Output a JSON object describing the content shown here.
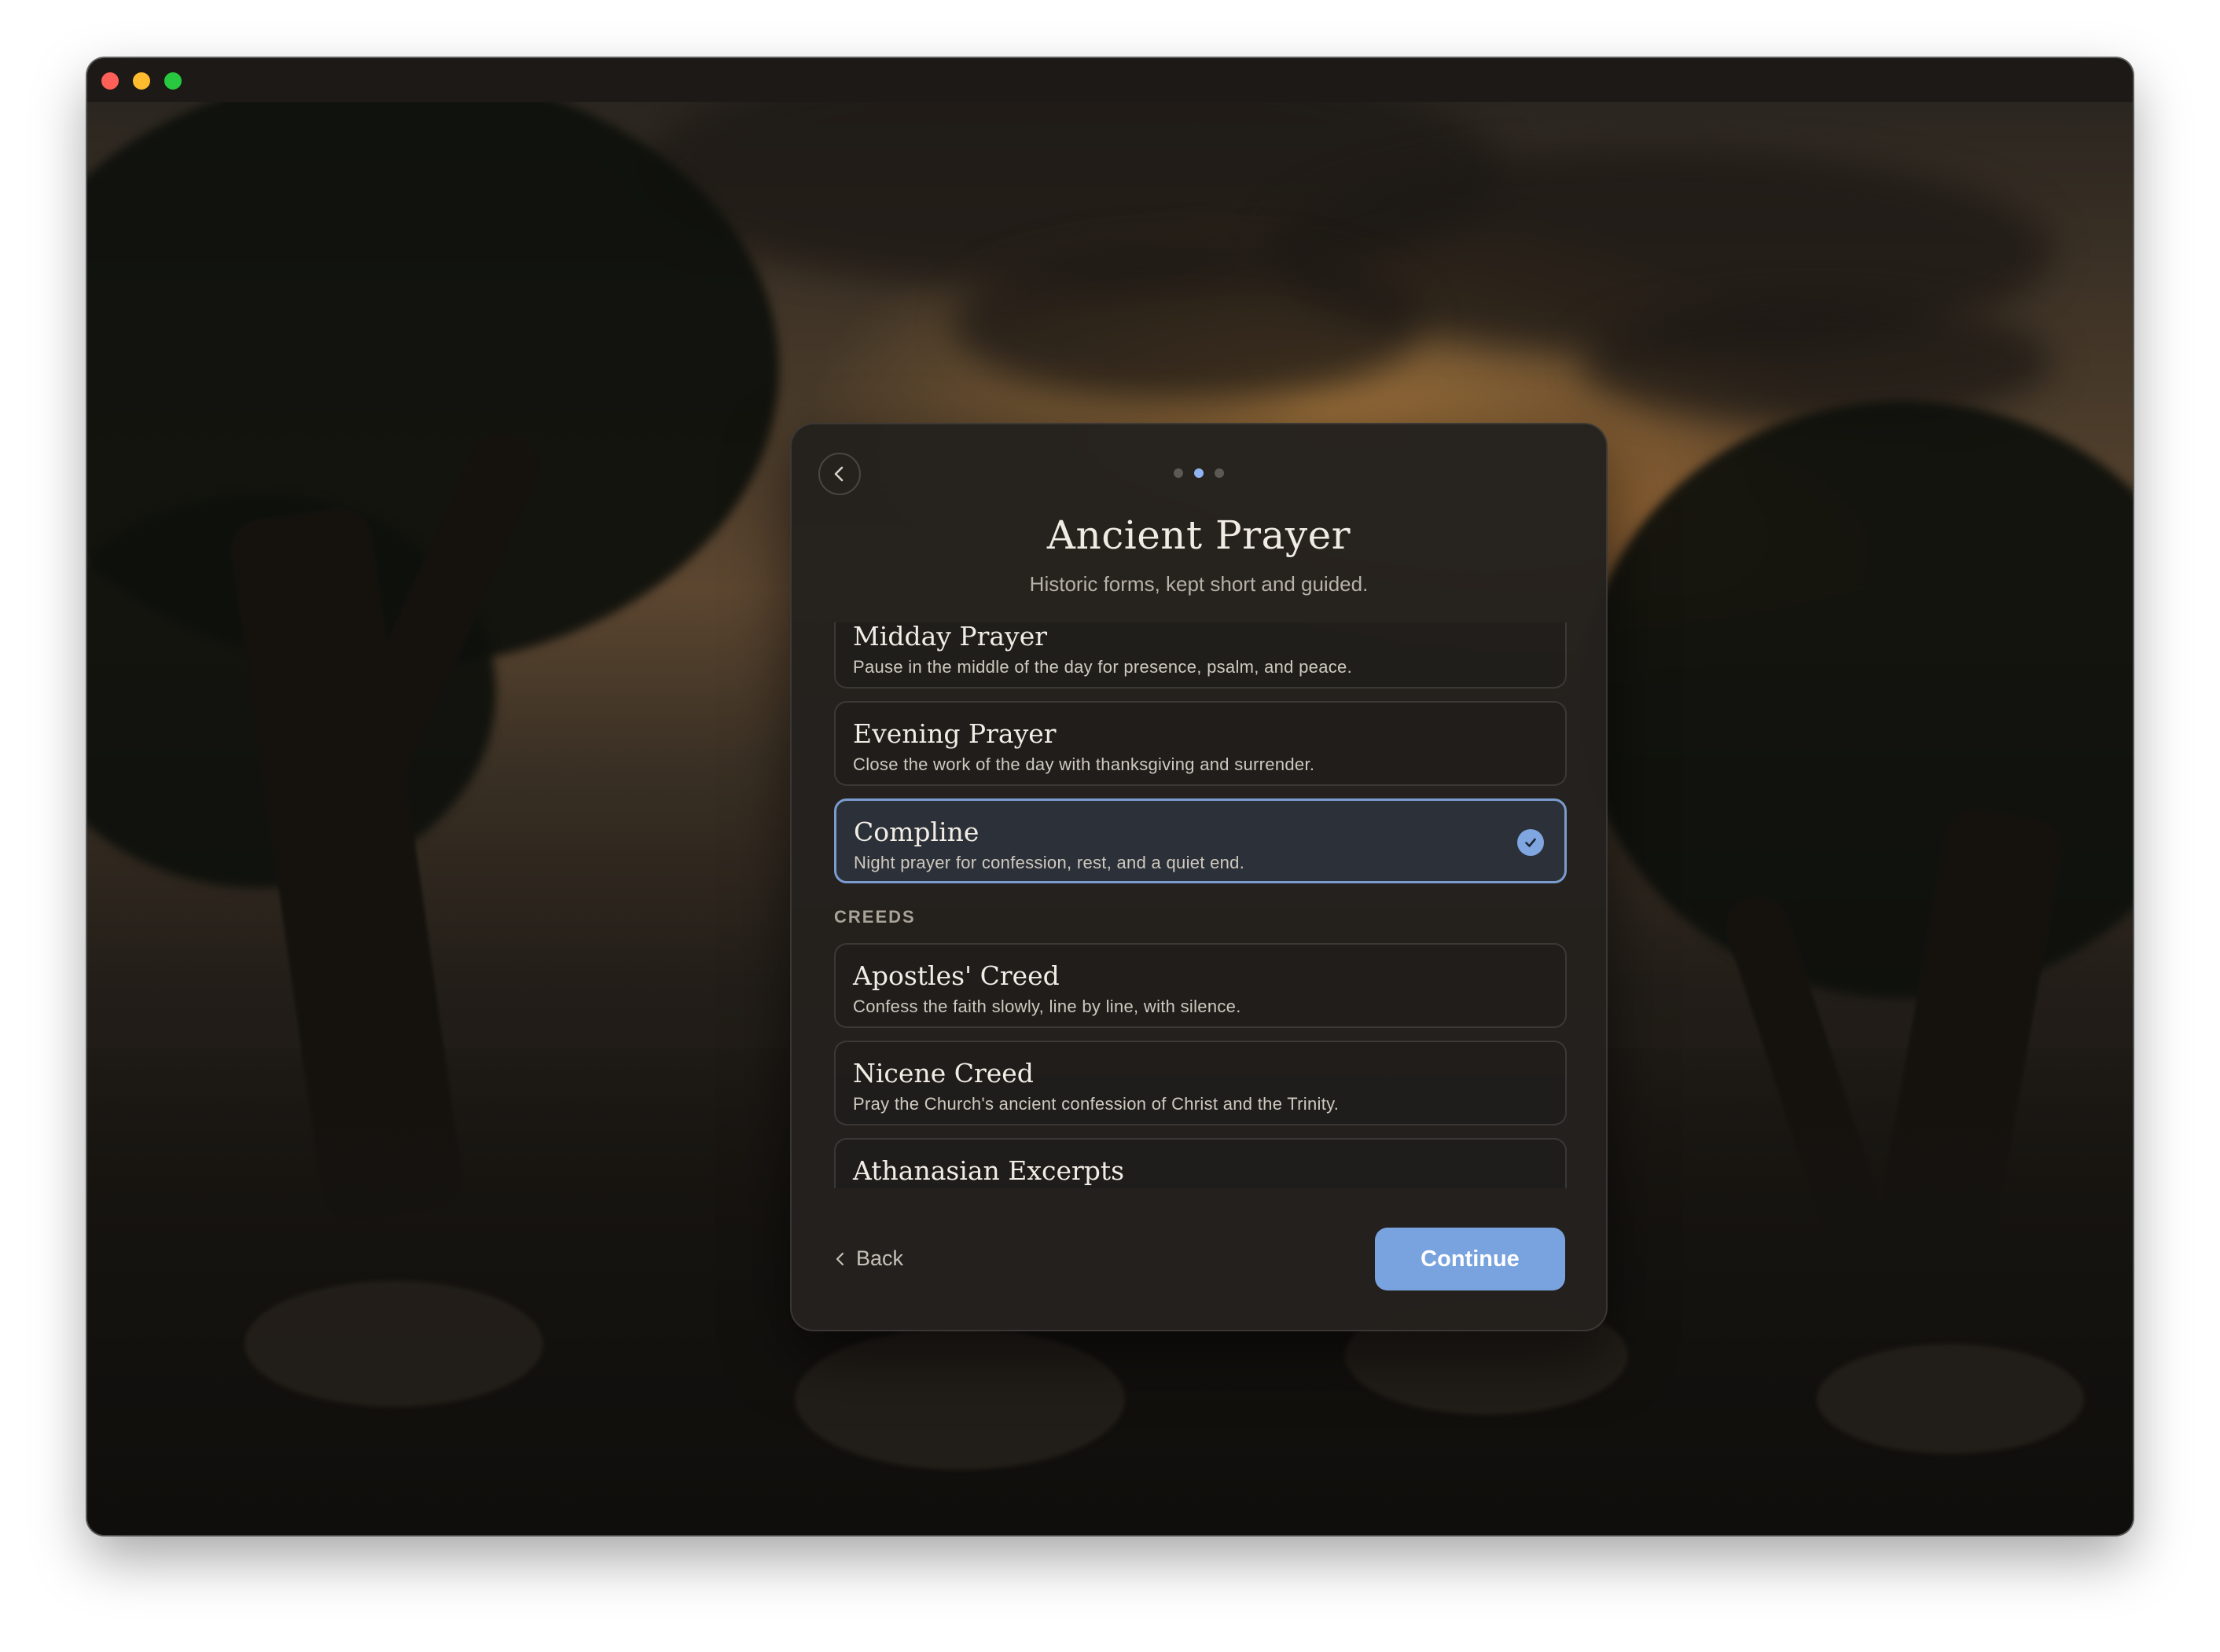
{
  "dialog": {
    "title": "Ancient Prayer",
    "subtitle": "Historic forms, kept short and guided.",
    "steps": {
      "current": 2,
      "total": 3
    }
  },
  "list": {
    "prayers": [
      {
        "title": "Midday Prayer",
        "description": "Pause in the middle of the day for presence, psalm, and peace.",
        "selected": false
      },
      {
        "title": "Evening Prayer",
        "description": "Close the work of the day with thanksgiving and surrender.",
        "selected": false
      },
      {
        "title": "Compline",
        "description": "Night prayer for confession, rest, and a quiet end.",
        "selected": true
      }
    ],
    "creeds_label": "CREEDS",
    "creeds": [
      {
        "title": "Apostles' Creed",
        "description": "Confess the faith slowly, line by line, with silence."
      },
      {
        "title": "Nicene Creed",
        "description": "Pray the Church's ancient confession of Christ and the Trinity."
      },
      {
        "title": "Athanasian Excerpts",
        "description": ""
      }
    ]
  },
  "footer": {
    "back_label": "Back",
    "continue_label": "Continue"
  },
  "colors": {
    "accent": "#79a3de",
    "selected_border": "#7b9ccf",
    "window_bg": "#1a1714"
  }
}
